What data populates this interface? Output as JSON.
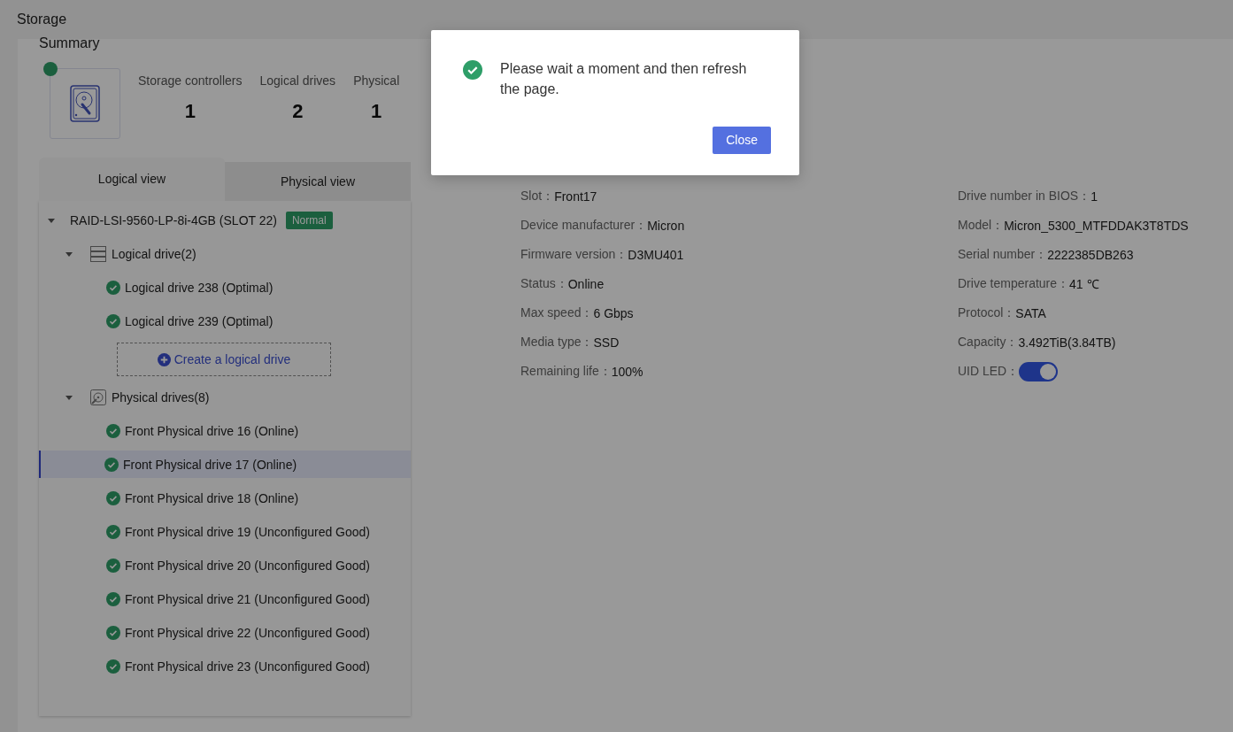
{
  "header": {
    "title": "Storage"
  },
  "summary": {
    "title": "Summary",
    "stats": [
      {
        "label": "Storage controllers",
        "value": "1"
      },
      {
        "label": "Logical drives",
        "value": "2"
      },
      {
        "label": "Physical",
        "value": "1"
      }
    ]
  },
  "tabs": [
    {
      "label": "Logical view",
      "selected": true
    },
    {
      "label": "Physical view",
      "selected": false
    }
  ],
  "tree": {
    "label": "RAID-LSI-9560-LP-8i-4GB (SLOT 22)",
    "badge": "Normal",
    "expanded": true,
    "children": [
      {
        "label": "Logical drive(2)",
        "kind": "logical-group",
        "expanded": true,
        "action": "Create a logical drive",
        "children": [
          {
            "label": "Logical drive 238 (Optimal)",
            "selected": false
          },
          {
            "label": "Logical drive 239 (Optimal)",
            "selected": false
          }
        ]
      },
      {
        "label": "Physical drives(8)",
        "kind": "physical-group",
        "expanded": true,
        "children": [
          {
            "label": "Front Physical drive 16 (Online)",
            "selected": false
          },
          {
            "label": "Front Physical drive 17 (Online)",
            "selected": true
          },
          {
            "label": "Front Physical drive 18 (Online)",
            "selected": false
          },
          {
            "label": "Front Physical drive 19 (Unconfigured Good)",
            "selected": false
          },
          {
            "label": "Front Physical drive 20 (Unconfigured Good)",
            "selected": false
          },
          {
            "label": "Front Physical drive 21 (Unconfigured Good)",
            "selected": false
          },
          {
            "label": "Front Physical drive 22 (Unconfigured Good)",
            "selected": false
          },
          {
            "label": "Front Physical drive 23 (Unconfigured Good)",
            "selected": false
          }
        ]
      }
    ]
  },
  "details": {
    "left": [
      {
        "label": "Slot：",
        "value": "Front17"
      },
      {
        "label": "Device manufacturer：",
        "value": "Micron"
      },
      {
        "label": "Firmware version：",
        "value": "D3MU401"
      },
      {
        "label": "Status：",
        "value": "Online"
      },
      {
        "label": "Max speed：",
        "value": "6 Gbps"
      },
      {
        "label": "Media type：",
        "value": "SSD"
      },
      {
        "label": "Remaining life：",
        "value": "100%"
      }
    ],
    "right": [
      {
        "label": "Drive number in BIOS：",
        "value": "1",
        "kind": "text"
      },
      {
        "label": "Model：",
        "value": "Micron_5300_MTFDDAK3T8TDS",
        "kind": "text"
      },
      {
        "label": "Serial number：",
        "value": "2222385DB263",
        "kind": "text"
      },
      {
        "label": "Drive temperature：",
        "value": "41 ℃",
        "kind": "text"
      },
      {
        "label": "Protocol：",
        "value": "SATA",
        "kind": "text"
      },
      {
        "label": "Capacity：",
        "value": "3.492TiB(3.84TB)",
        "kind": "text"
      },
      {
        "label": "UID LED：",
        "kind": "toggle",
        "on": true
      }
    ]
  },
  "dialog": {
    "message": "Please wait a moment and then refresh the page.",
    "button": "Close"
  }
}
